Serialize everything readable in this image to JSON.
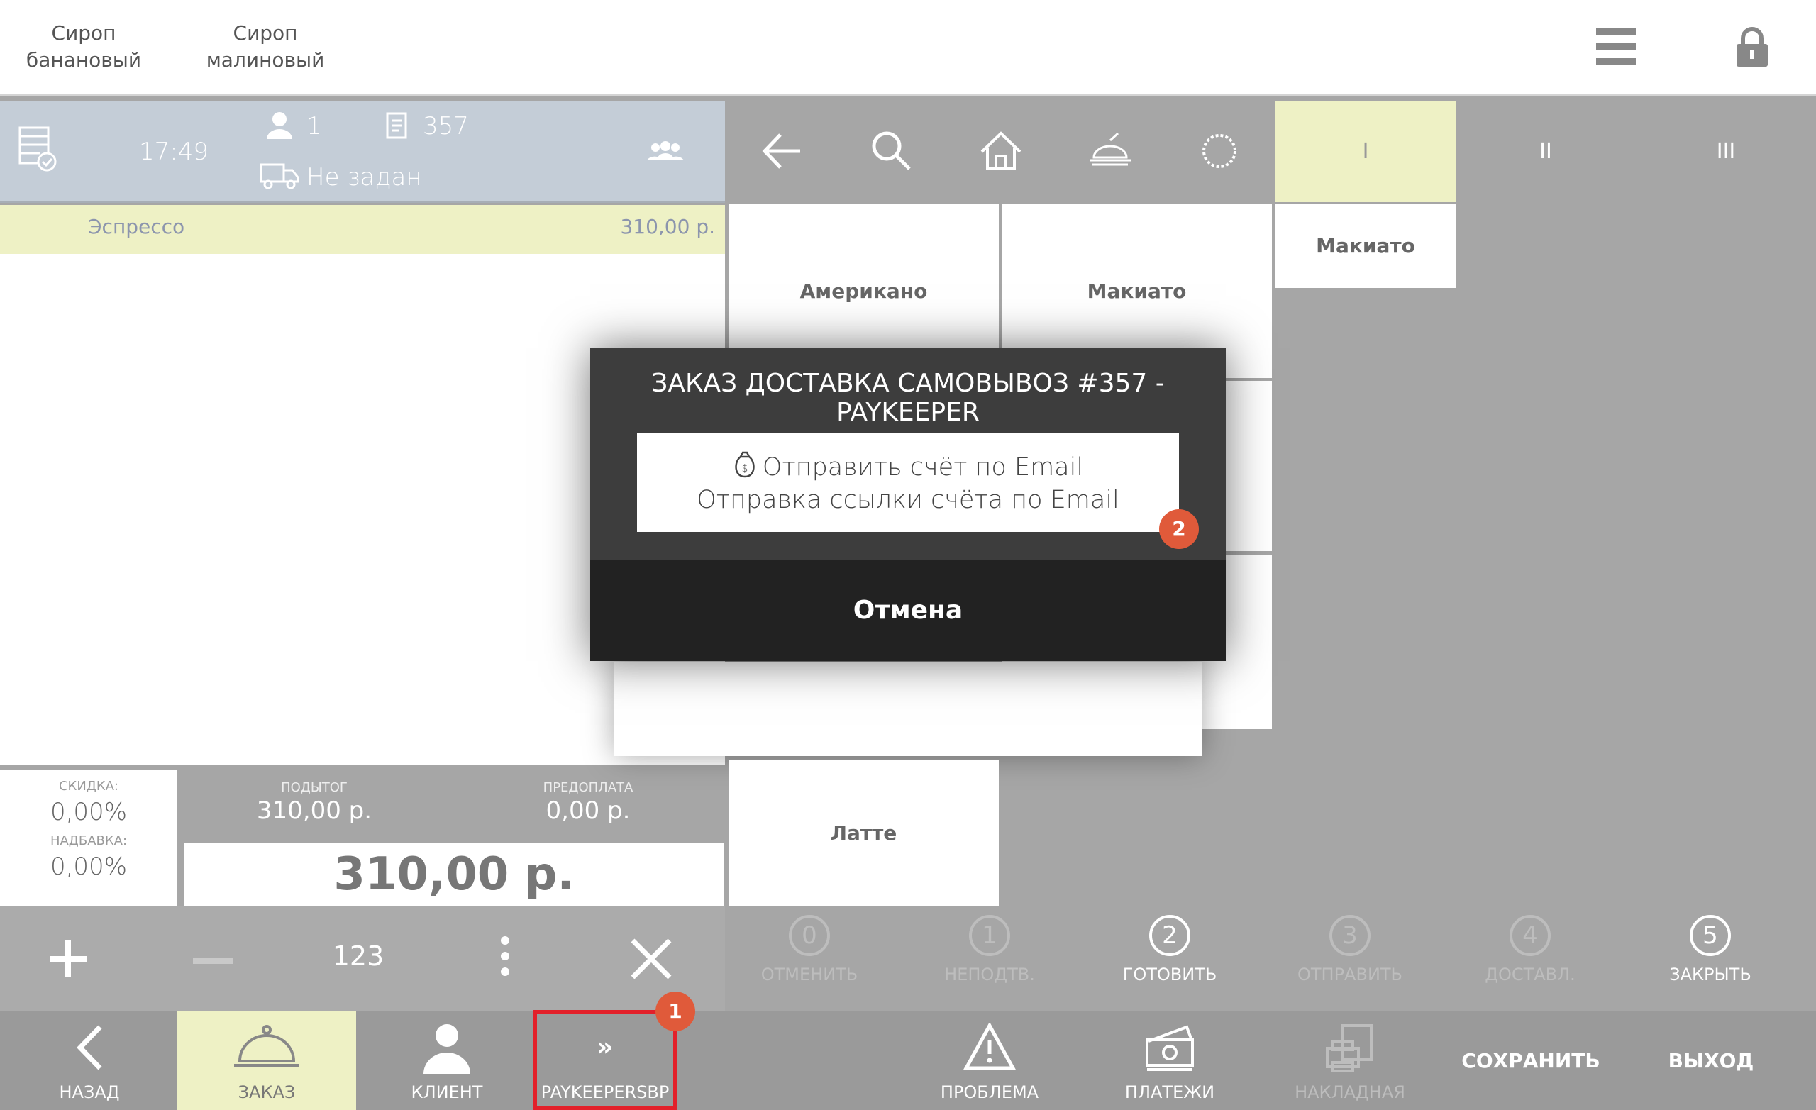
{
  "topbar": {
    "syrups": [
      "Сироп банановый",
      "Сироп малиновый"
    ],
    "menu_icon": "hamburger-icon",
    "lock_icon": "lock-icon"
  },
  "order_header": {
    "time": "17:49",
    "guests": "1",
    "order_number": "357",
    "delivery": "Не задан"
  },
  "order_items": [
    {
      "name": "Эспрессо",
      "price": "310,00 р."
    }
  ],
  "totals": {
    "discount_label": "СКИДКА:",
    "discount": "0,00%",
    "markup_label": "НАДБАВКА:",
    "markup": "0,00%",
    "subtotal_label": "ПОДЫТОГ",
    "subtotal": "310,00 р.",
    "prepay_label": "ПРЕДОПЛАТА",
    "prepay": "0,00 р.",
    "total": "310,00 р."
  },
  "actions": {
    "qty": "123"
  },
  "tabs": [
    "I",
    "II",
    "III"
  ],
  "menu_tiles": {
    "col3_top": "Макиато",
    "tile1": "Американо",
    "tile2": "Макиато",
    "tile3": "Латте"
  },
  "statuses": [
    {
      "num": "0",
      "label": "ОТМЕНИТЬ"
    },
    {
      "num": "1",
      "label": "НЕПОДТВ."
    },
    {
      "num": "2",
      "label": "ГОТОВИТЬ"
    },
    {
      "num": "3",
      "label": "ОТПРАВИТЬ"
    },
    {
      "num": "4",
      "label": "ДОСТАВЛ."
    },
    {
      "num": "5",
      "label": "ЗАКРЫТЬ"
    }
  ],
  "bottom_nav": {
    "back": "НАЗАД",
    "order": "ЗАКАЗ",
    "client": "КЛИЕНТ",
    "paykeeper": "PAYKEEPERSBP",
    "problem": "ПРОБЛЕМА",
    "payments": "ПЛАТЕЖИ",
    "invoice": "НАКЛАДНАЯ",
    "save": "СОХРАНИТЬ",
    "exit": "ВЫХОД"
  },
  "dialog": {
    "title": "ЗАКАЗ ДОСТАВКА САМОВЫВОЗ #357 - PAYKEEPER",
    "option_line1": "Отправить счёт по Email",
    "option_line2": "Отправка ссылки счёта по Email",
    "cancel": "Отмена"
  },
  "badges": {
    "one": "1",
    "two": "2"
  },
  "colors": {
    "accent_yellow": "#eef1c5",
    "header_blue": "#c4cdd7",
    "badge": "#e05a3a",
    "highlight": "#e3202a"
  }
}
